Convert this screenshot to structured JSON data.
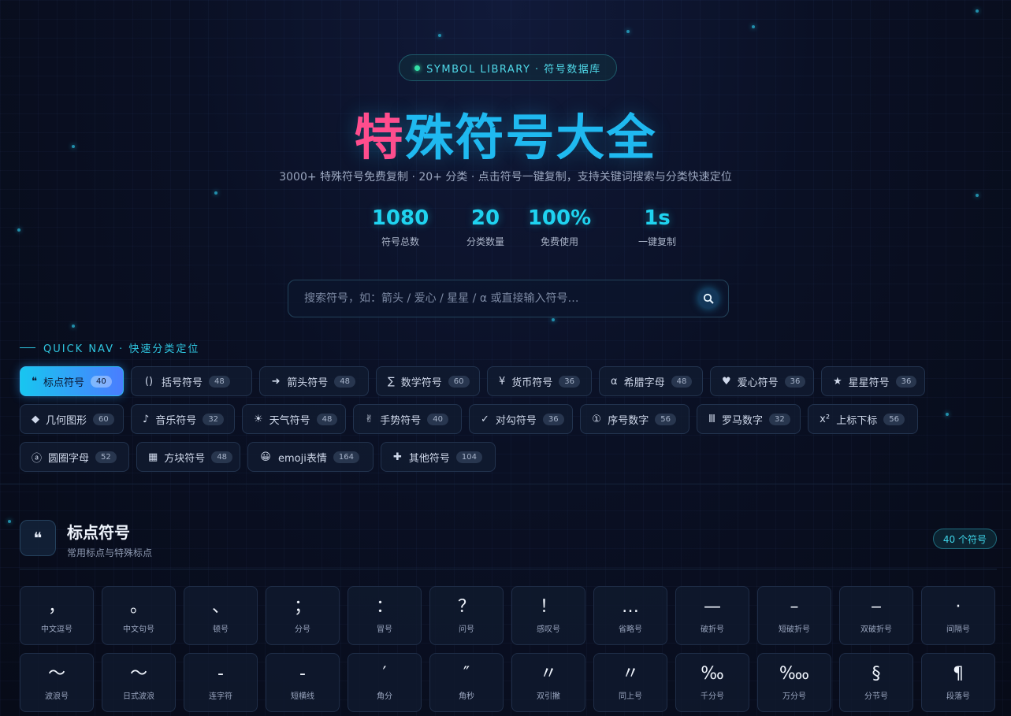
{
  "hero": {
    "badge": "SYMBOL LIBRARY · 符号数据库",
    "title_first": "特",
    "title_rest": "殊符号大全",
    "subtitle": "3000+ 特殊符号免费复制 · 20+ 分类 · 点击符号一键复制，支持关键词搜索与分类快速定位"
  },
  "stats": [
    {
      "value": "1080",
      "label": "符号总数"
    },
    {
      "value": "20",
      "label": "分类数量"
    },
    {
      "value": "100%",
      "label": "免费使用"
    },
    {
      "value": "1s",
      "label": "一键复制"
    }
  ],
  "search": {
    "placeholder": "搜索符号，如：箭头 / 爱心 / 星星 / α 或直接输入符号…",
    "icon": "search-icon"
  },
  "quick_nav": {
    "label": "QUICK NAV · 快速分类定位",
    "rows": [
      [
        {
          "icon": "❝",
          "label": "标点符号",
          "count": "40",
          "active": true
        },
        {
          "icon": "()",
          "label": "括号符号",
          "count": "48"
        },
        {
          "icon": "➜",
          "label": "箭头符号",
          "count": "48"
        },
        {
          "icon": "∑",
          "label": "数学符号",
          "count": "60"
        },
        {
          "icon": "¥",
          "label": "货币符号",
          "count": "36"
        },
        {
          "icon": "α",
          "label": "希腊字母",
          "count": "48"
        },
        {
          "icon": "♥",
          "label": "爱心符号",
          "count": "36"
        },
        {
          "icon": "★",
          "label": "星星符号",
          "count": "36"
        }
      ],
      [
        {
          "icon": "◆",
          "label": "几何图形",
          "count": "60"
        },
        {
          "icon": "♪",
          "label": "音乐符号",
          "count": "32"
        },
        {
          "icon": "☀",
          "label": "天气符号",
          "count": "48"
        },
        {
          "icon": "✌",
          "label": "手势符号",
          "count": "40"
        },
        {
          "icon": "✓",
          "label": "对勾符号",
          "count": "36"
        },
        {
          "icon": "①",
          "label": "序号数字",
          "count": "56"
        },
        {
          "icon": "Ⅲ",
          "label": "罗马数字",
          "count": "32"
        },
        {
          "icon": "x²",
          "label": "上标下标",
          "count": "56"
        }
      ],
      [
        {
          "icon": "ⓐ",
          "label": "圆圈字母",
          "count": "52"
        },
        {
          "icon": "▦",
          "label": "方块符号",
          "count": "48"
        },
        {
          "icon": "😀",
          "label": "emoji表情",
          "count": "164"
        },
        {
          "icon": "✚",
          "label": "其他符号",
          "count": "104"
        }
      ]
    ]
  },
  "section": {
    "icon": "❝",
    "title": "标点符号",
    "desc": "常用标点与特殊标点",
    "count": "40 个符号",
    "cards": [
      {
        "sym": "，",
        "name": "中文逗号"
      },
      {
        "sym": "。",
        "name": "中文句号"
      },
      {
        "sym": "、",
        "name": "顿号"
      },
      {
        "sym": "；",
        "name": "分号"
      },
      {
        "sym": "：",
        "name": "冒号"
      },
      {
        "sym": "？",
        "name": "问号"
      },
      {
        "sym": "！",
        "name": "感叹号"
      },
      {
        "sym": "…",
        "name": "省略号"
      },
      {
        "sym": "—",
        "name": "破折号"
      },
      {
        "sym": "–",
        "name": "短破折号"
      },
      {
        "sym": "‒",
        "name": "双破折号"
      },
      {
        "sym": "·",
        "name": "间隔号"
      },
      {
        "sym": "～",
        "name": "波浪号"
      },
      {
        "sym": "〜",
        "name": "日式波浪"
      },
      {
        "sym": "‐",
        "name": "连字符"
      },
      {
        "sym": "-",
        "name": "短横线"
      },
      {
        "sym": "′",
        "name": "角分"
      },
      {
        "sym": "″",
        "name": "角秒"
      },
      {
        "sym": "〃",
        "name": "双引撇"
      },
      {
        "sym": "〃",
        "name": "同上号"
      },
      {
        "sym": "‰",
        "name": "千分号"
      },
      {
        "sym": "‱",
        "name": "万分号"
      },
      {
        "sym": "§",
        "name": "分节号"
      },
      {
        "sym": "¶",
        "name": "段落号"
      }
    ]
  }
}
